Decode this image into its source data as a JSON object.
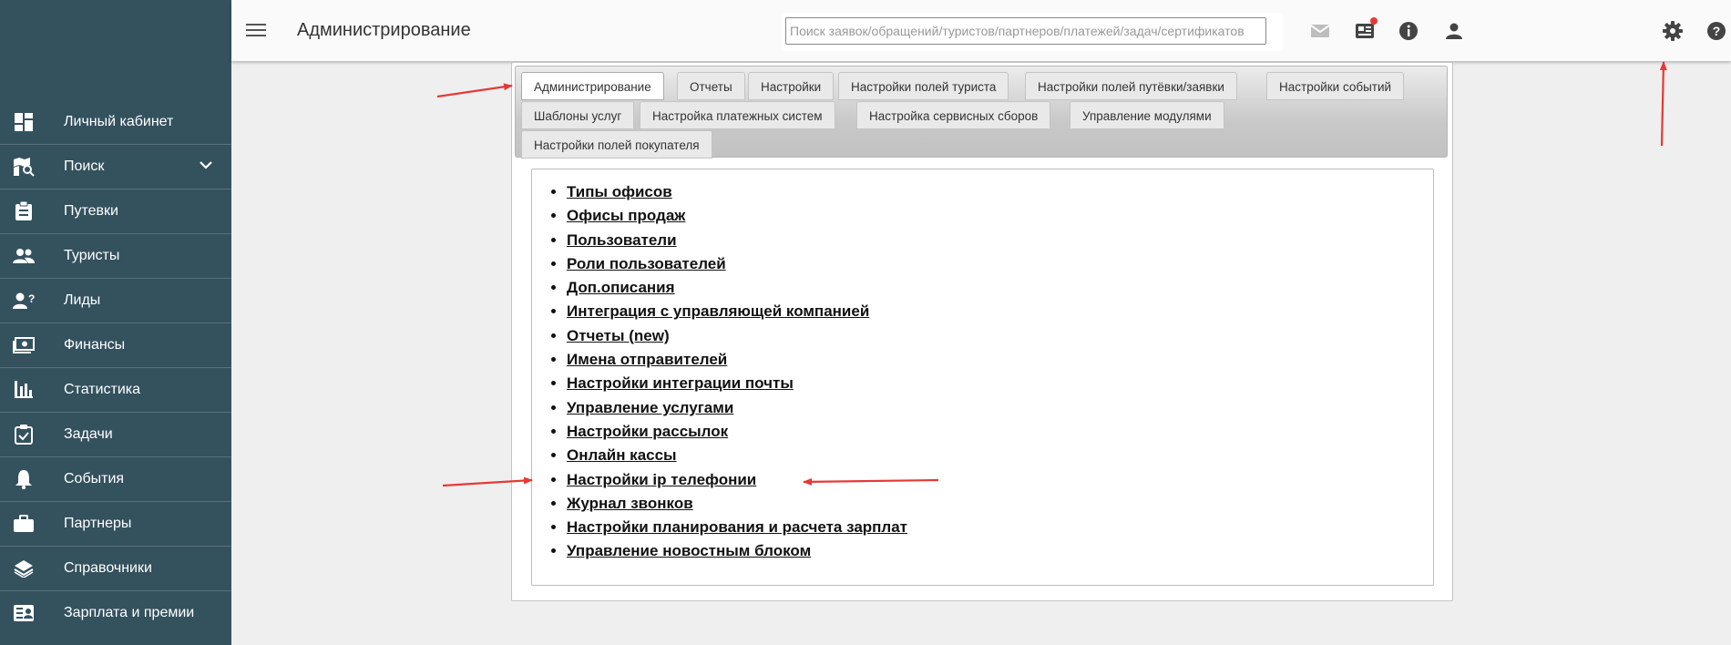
{
  "sidebar": {
    "items": [
      {
        "label": "Личный кабинет",
        "icon": "dashboard-icon"
      },
      {
        "label": "Поиск",
        "icon": "map-search-icon",
        "expandable": true
      },
      {
        "label": "Путевки",
        "icon": "clipboard-icon"
      },
      {
        "label": "Туристы",
        "icon": "people-icon"
      },
      {
        "label": "Лиды",
        "icon": "person-question-icon"
      },
      {
        "label": "Финансы",
        "icon": "money-icon"
      },
      {
        "label": "Статистика",
        "icon": "bar-chart-icon"
      },
      {
        "label": "Задачи",
        "icon": "task-check-icon"
      },
      {
        "label": "События",
        "icon": "bell-icon"
      },
      {
        "label": "Партнеры",
        "icon": "briefcase-icon"
      },
      {
        "label": "Справочники",
        "icon": "layers-icon"
      },
      {
        "label": "Зарплата и премии",
        "icon": "id-card-icon"
      }
    ]
  },
  "header": {
    "title": "Администрирование",
    "search": {
      "placeholder": "Поиск заявок/обращений/туристов/партнеров/платежей/задач/сертификатов",
      "value": ""
    },
    "icons": [
      "mail-icon",
      "news-icon",
      "info-icon",
      "user-icon",
      "settings-gear-icon",
      "help-icon"
    ]
  },
  "tabs": {
    "active": "Администрирование",
    "items": [
      "Администрирование",
      "Отчеты",
      "Настройки",
      "Настройки полей туриста",
      "Настройки полей путёвки/заявки",
      "Настройки событий",
      "Шаблоны услуг",
      "Настройка платежных систем",
      "Настройка сервисных сборов",
      "Управление модулями",
      "Настройки полей покупателя"
    ]
  },
  "links": [
    "Типы офисов",
    "Офисы продаж",
    "Пользователи",
    "Роли пользователей",
    "Доп.описания",
    "Интеграция с управляющей компанией",
    "Отчеты (new)",
    "Имена отправителей",
    "Настройки интеграции почты",
    "Управление услугами",
    "Настройки рассылок",
    "Онлайн кассы",
    "Настройки ip телефонии",
    "Журнал звонков",
    "Настройки планирования и расчета зарплат",
    "Управление новостным блоком"
  ],
  "colors": {
    "sidebar": "#34515e",
    "annotation_arrow": "#e53935",
    "notification_dot": "#e53935"
  }
}
